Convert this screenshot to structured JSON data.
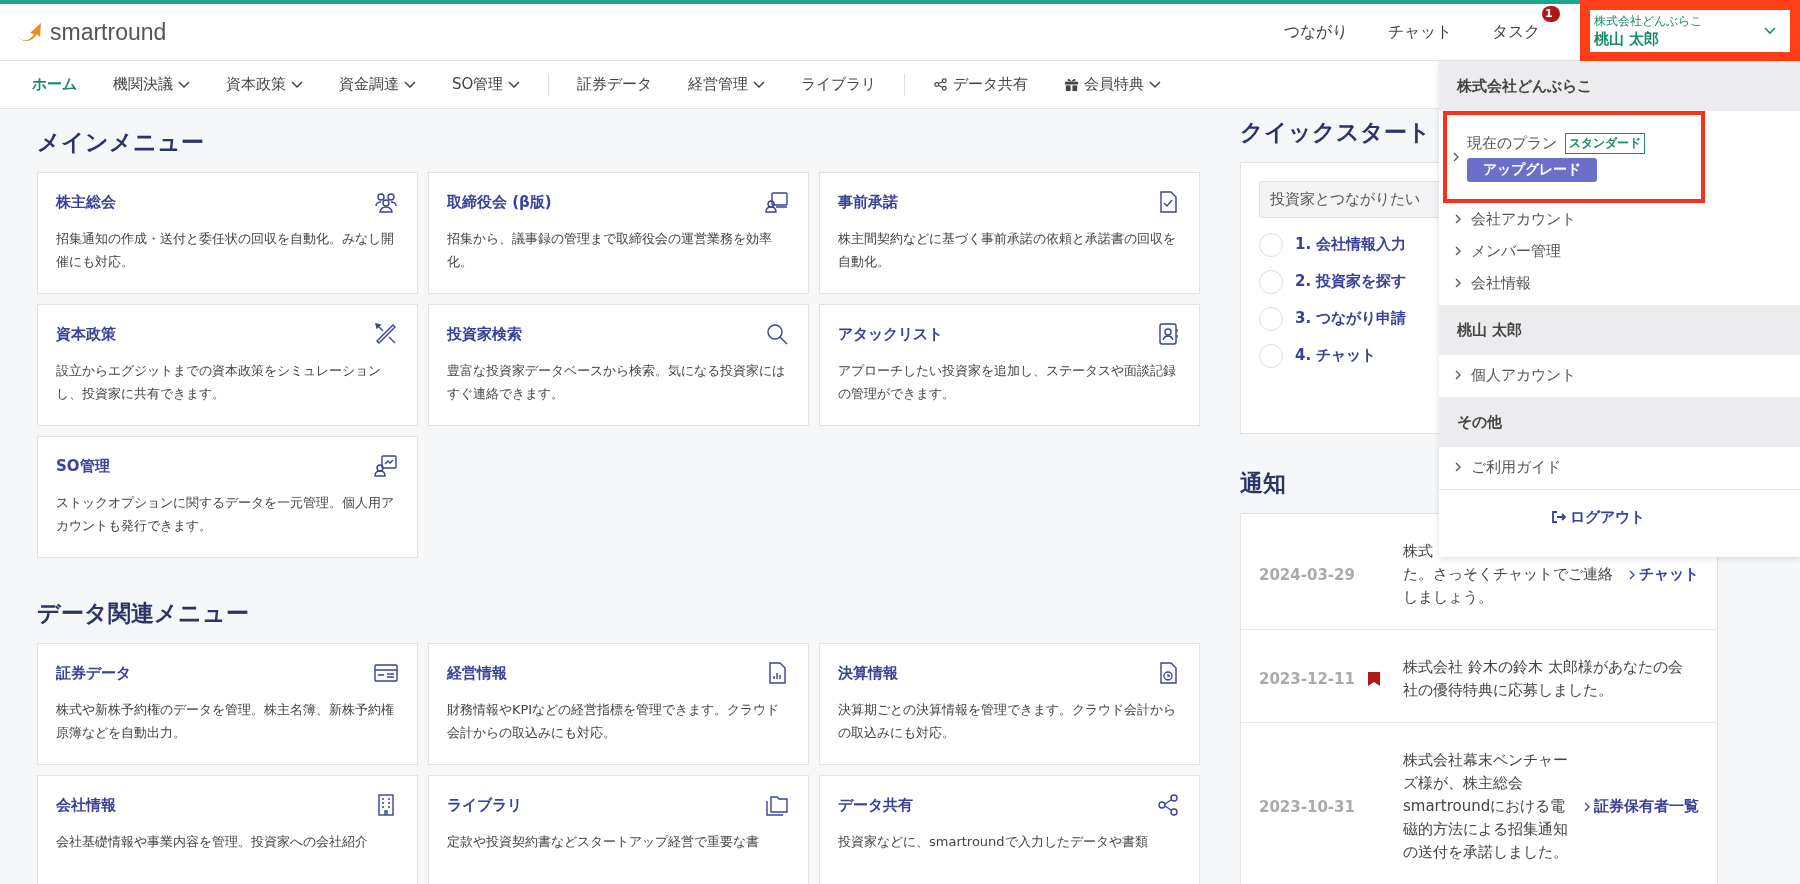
{
  "header": {
    "logo": "smartround",
    "links": [
      {
        "label": "つながり"
      },
      {
        "label": "チャット"
      },
      {
        "label": "タスク",
        "badge": "1"
      }
    ],
    "account": {
      "company": "株式会社どんぶらこ",
      "user": "桃山 太郎",
      "expanded": true,
      "highlighted": true
    }
  },
  "nav": [
    {
      "items": [
        {
          "label": "ホーム",
          "selected": true,
          "dropdown": false
        },
        {
          "label": "機関決議",
          "selected": false,
          "dropdown": true
        },
        {
          "label": "資本政策",
          "selected": false,
          "dropdown": true
        },
        {
          "label": "資金調達",
          "selected": false,
          "dropdown": true
        },
        {
          "label": "SO管理",
          "selected": false,
          "dropdown": true
        }
      ]
    },
    {
      "items": [
        {
          "label": "証券データ",
          "selected": false,
          "dropdown": false
        },
        {
          "label": "経営管理",
          "selected": false,
          "dropdown": true
        },
        {
          "label": "ライブラリ",
          "selected": false,
          "dropdown": false
        }
      ]
    },
    {
      "items": [
        {
          "label": "データ共有",
          "selected": false,
          "dropdown": false
        },
        {
          "label": "会員特典",
          "selected": false,
          "dropdown": true
        }
      ]
    }
  ],
  "main_menu": {
    "title": "メインメニュー",
    "cards": [
      {
        "title": "株主総会",
        "description": "招集通知の作成・送付と委任状の回収を自動化。みなし開催にも対応。"
      },
      {
        "title": "取締役会 (β版)",
        "description": "招集から、議事録の管理まで取締役会の運営業務を効率化。"
      },
      {
        "title": "事前承諾",
        "description": "株主間契約などに基づく事前承諾の依頼と承諾書の回収を自動化。"
      },
      {
        "title": "資本政策",
        "description": "設立からエグジットまでの資本政策をシミュレーションし、投資家に共有できます。"
      },
      {
        "title": "投資家検索",
        "description": "豊富な投資家データベースから検索。気になる投資家にはすぐ連絡できます。"
      },
      {
        "title": "アタックリスト",
        "description": "アプローチしたい投資家を追加し、ステータスや面談記録の管理ができます。"
      },
      {
        "title": "SO管理",
        "description": "ストックオプションに関するデータを一元管理。個人用アカウントも発行できます。"
      }
    ]
  },
  "data_menu": {
    "title": "データ関連メニュー",
    "cards": [
      {
        "title": "証券データ",
        "description": "株式や新株予約権のデータを管理。株主名簿、新株予約権原簿などを自動出力。"
      },
      {
        "title": "経営情報",
        "description": "財務情報やKPIなどの経営指標を管理できます。クラウド会計からの取込みにも対応。"
      },
      {
        "title": "決算情報",
        "description": "決算期ごとの決算情報を管理できます。クラウド会計からの取込みにも対応。"
      },
      {
        "title": "会社情報",
        "description": "会社基礎情報や事業内容を管理。投資家への会社紹介"
      },
      {
        "title": "ライブラリ",
        "description": "定款や投資契約書などスタートアップ経営で重要な書"
      },
      {
        "title": "データ共有",
        "description": "投資家などに、smartroundで入力したデータや書類"
      }
    ]
  },
  "quick_start": {
    "title": "クイックスタート",
    "select": {
      "value": "投資家とつながりたい"
    },
    "steps": [
      {
        "label": "1. 会社情報入力",
        "done": false
      },
      {
        "label": "2. 投資家を探す",
        "done": false
      },
      {
        "label": "3. つながり申請",
        "done": false
      },
      {
        "label": "4. チャット",
        "done": false
      }
    ]
  },
  "notifications": {
    "title": "通知",
    "items": [
      {
        "date": "2024-03-29",
        "flagged": false,
        "lines": [
          "株式",
          "た。さっそくチャットでご連絡",
          "しましょう。"
        ],
        "link": "チャット"
      },
      {
        "date": "2023-12-11",
        "flagged": true,
        "lines": [
          "株式会社 鈴木の鈴木 太郎様があなたの会",
          "社の優待特典に応募しました。"
        ]
      },
      {
        "date": "2023-10-31",
        "flagged": false,
        "lines": [
          "株式会社幕末ベンチャー",
          "ズ様が、株主総会",
          "smartroundにおける電",
          "磁的方法による招集通知",
          "の送付を承諾しました。"
        ],
        "link": "証券保有者一覧"
      }
    ]
  },
  "account_menu": {
    "sections": [
      {
        "heading": "株式会社どんぶらこ",
        "items": [
          {
            "kind": "plan",
            "label": "現在のプラン",
            "plan": "スタンダード",
            "action": "アップグレード",
            "highlighted": true
          },
          {
            "kind": "link",
            "label": "会社アカウント"
          },
          {
            "kind": "link",
            "label": "メンバー管理"
          },
          {
            "kind": "link",
            "label": "会社情報"
          }
        ]
      },
      {
        "heading": "桃山 太郎",
        "items": [
          {
            "kind": "link",
            "label": "個人アカウント"
          }
        ]
      },
      {
        "heading": "その他",
        "items": [
          {
            "kind": "link",
            "label": "ご利用ガイド"
          }
        ]
      }
    ],
    "logout": "ログアウト"
  }
}
